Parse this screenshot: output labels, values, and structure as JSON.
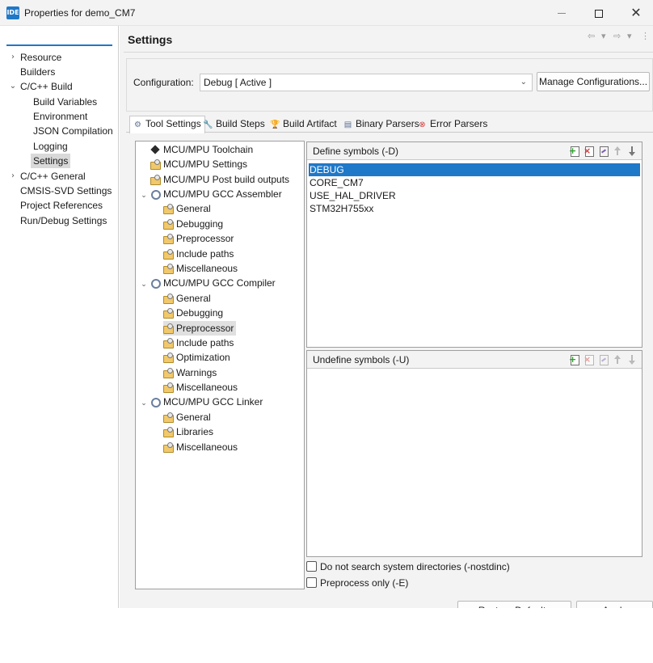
{
  "window": {
    "app_icon_text": "IDE",
    "title": "Properties for demo_CM7",
    "close_glyph": "✕"
  },
  "filter": {
    "value": "",
    "placeholder": ""
  },
  "nav": {
    "items": [
      {
        "label": "Resource",
        "expander": "›"
      },
      {
        "label": "Builders",
        "expander": ""
      },
      {
        "label": "C/C++ Build",
        "expander": "⌄"
      },
      {
        "label": "Build Variables",
        "expander": ""
      },
      {
        "label": "Environment",
        "expander": ""
      },
      {
        "label": "JSON Compilation",
        "expander": ""
      },
      {
        "label": "Logging",
        "expander": ""
      },
      {
        "label": "Settings",
        "expander": "",
        "selected": true
      },
      {
        "label": "C/C++ General",
        "expander": "›"
      },
      {
        "label": "CMSIS-SVD Settings",
        "expander": ""
      },
      {
        "label": "Project References",
        "expander": ""
      },
      {
        "label": "Run/Debug Settings",
        "expander": ""
      }
    ]
  },
  "header": {
    "title": "Settings",
    "back_glyph": "⇦",
    "forward_glyph": "⇨",
    "dropdown_glyph": "▾",
    "menu_glyph": "⋮"
  },
  "configuration": {
    "label": "Configuration:",
    "value": "Debug  [ Active ]",
    "chevron": "⌄",
    "manage_button": "Manage Configurations..."
  },
  "tabs": [
    {
      "label": "Tool Settings",
      "icon": "gear-icon",
      "glyph": "⚙",
      "color": "#5d7393",
      "active": true
    },
    {
      "label": "Build Steps",
      "icon": "wrench-icon",
      "glyph": "🔧",
      "color": "#5f79a8"
    },
    {
      "label": "Build Artifact",
      "icon": "trophy-icon",
      "glyph": "🏆",
      "color": "#d9a21b"
    },
    {
      "label": "Binary Parsers",
      "icon": "binary-icon",
      "glyph": "▤",
      "color": "#5a6f93"
    },
    {
      "label": "Error Parsers",
      "icon": "error-icon",
      "glyph": "⊗",
      "color": "#d23a3a"
    }
  ],
  "tool_tree": {
    "items": [
      {
        "label": "MCU/MPU Toolchain",
        "icon": "diamond"
      },
      {
        "label": "MCU/MPU Settings",
        "icon": "opt"
      },
      {
        "label": "MCU/MPU Post build outputs",
        "icon": "opt"
      },
      {
        "label": "MCU/MPU GCC Assembler",
        "icon": "gear",
        "expander": "⌄"
      },
      {
        "label": "General",
        "icon": "opt"
      },
      {
        "label": "Debugging",
        "icon": "opt"
      },
      {
        "label": "Preprocessor",
        "icon": "opt"
      },
      {
        "label": "Include paths",
        "icon": "opt"
      },
      {
        "label": "Miscellaneous",
        "icon": "opt"
      },
      {
        "label": "MCU/MPU GCC Compiler",
        "icon": "gear",
        "expander": "⌄"
      },
      {
        "label": "General",
        "icon": "opt"
      },
      {
        "label": "Debugging",
        "icon": "opt"
      },
      {
        "label": "Preprocessor",
        "icon": "opt",
        "selected": true
      },
      {
        "label": "Include paths",
        "icon": "opt"
      },
      {
        "label": "Optimization",
        "icon": "opt"
      },
      {
        "label": "Warnings",
        "icon": "opt"
      },
      {
        "label": "Miscellaneous",
        "icon": "opt"
      },
      {
        "label": "MCU/MPU GCC Linker",
        "icon": "gear",
        "expander": "⌄"
      },
      {
        "label": "General",
        "icon": "opt"
      },
      {
        "label": "Libraries",
        "icon": "opt"
      },
      {
        "label": "Miscellaneous",
        "icon": "opt"
      }
    ]
  },
  "define_symbols": {
    "title": "Define symbols (-D)",
    "items": [
      "DEBUG",
      "CORE_CM7",
      "USE_HAL_DRIVER",
      "STM32H755xx"
    ],
    "selected_index": 0
  },
  "undefine_symbols": {
    "title": "Undefine symbols (-U)",
    "items": []
  },
  "options": {
    "nostdinc": {
      "label": "Do not search system directories (-nostdinc)",
      "checked": false
    },
    "preprocess_only": {
      "label": "Preprocess only (-E)",
      "checked": false
    }
  },
  "bottom_buttons": {
    "restore": "Restore Defaults",
    "apply": "Apply"
  },
  "colors": {
    "accent": "#1f78c8",
    "selection_bg": "#1f78c8",
    "panel_bg": "#f3f3f3"
  }
}
